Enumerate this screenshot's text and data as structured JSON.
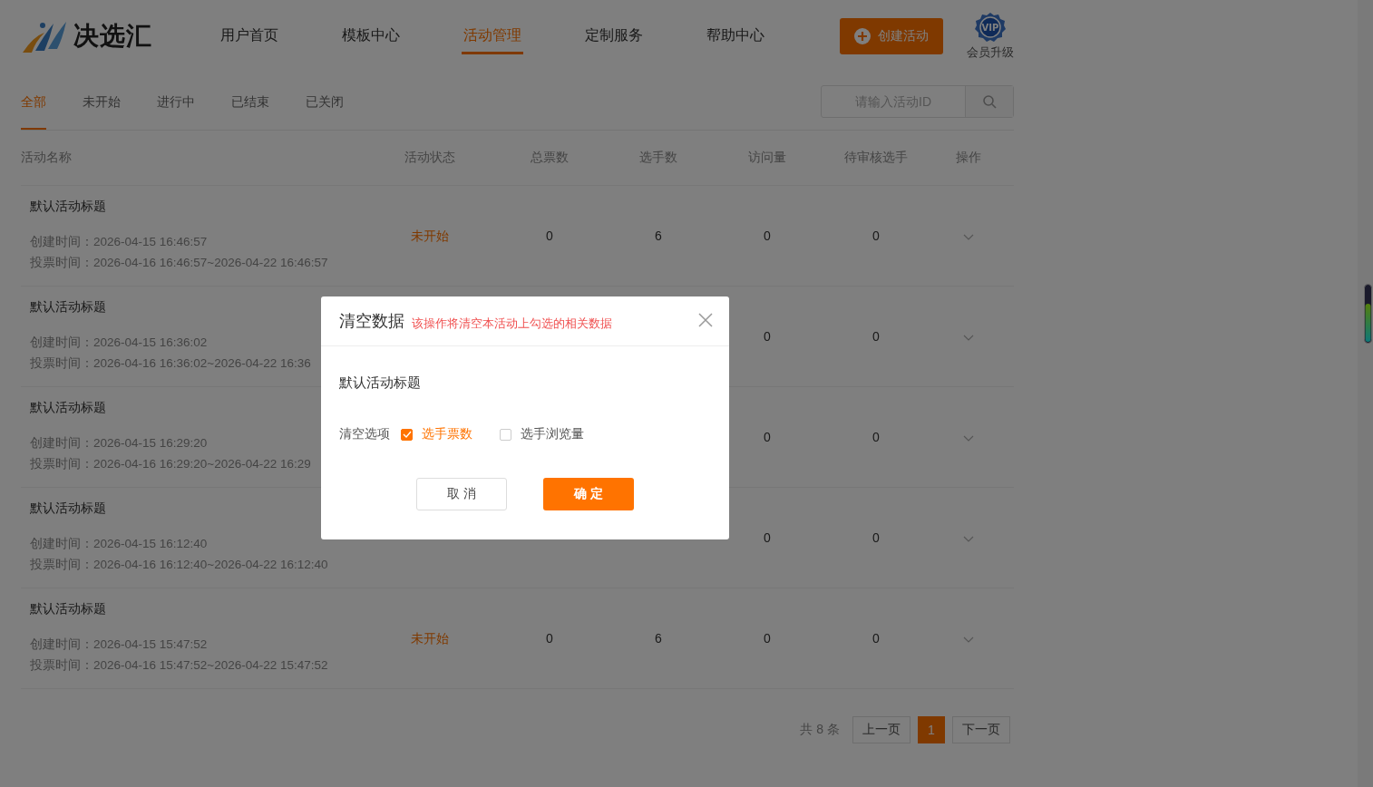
{
  "header": {
    "logo_text": "决选汇",
    "nav": [
      {
        "label": "用户首页",
        "selected": false
      },
      {
        "label": "模板中心",
        "selected": false
      },
      {
        "label": "活动管理",
        "selected": true
      },
      {
        "label": "定制服务",
        "selected": false
      },
      {
        "label": "帮助中心",
        "selected": false
      }
    ],
    "create_button": "创建活动",
    "vip_badge": "VIP",
    "vip_label": "会员升级"
  },
  "tabs": [
    {
      "label": "全部",
      "selected": true
    },
    {
      "label": "未开始",
      "selected": false
    },
    {
      "label": "进行中",
      "selected": false
    },
    {
      "label": "已结束",
      "selected": false
    },
    {
      "label": "已关闭",
      "selected": false
    }
  ],
  "search": {
    "placeholder": "请输入活动ID"
  },
  "table": {
    "columns": [
      "活动名称",
      "活动状态",
      "总票数",
      "选手数",
      "访问量",
      "待审核选手",
      "操作"
    ],
    "rows": [
      {
        "title": "默认活动标题",
        "created": "创建时间：2026-04-15 16:46:57",
        "voting": "投票时间：2026-04-16 16:46:57~2026-04-22 16:46:57",
        "status": "未开始",
        "total_votes": "0",
        "players": "6",
        "visits": "0",
        "pending": "0"
      },
      {
        "title": "默认活动标题",
        "created": "创建时间：2026-04-15 16:36:02",
        "voting": "投票时间：2026-04-16 16:36:02~2026-04-22 16:36",
        "visits": "0",
        "pending": "0"
      },
      {
        "title": "默认活动标题",
        "created": "创建时间：2026-04-15 16:29:20",
        "voting": "投票时间：2026-04-16 16:29:20~2026-04-22 16:29",
        "visits": "0",
        "pending": "0"
      },
      {
        "title": "默认活动标题",
        "created": "创建时间：2026-04-15 16:12:40",
        "voting": "投票时间：2026-04-16 16:12:40~2026-04-22 16:12:40",
        "visits": "0",
        "pending": "0"
      },
      {
        "title": "默认活动标题",
        "created": "创建时间：2026-04-15 15:47:52",
        "voting": "投票时间：2026-04-16 15:47:52~2026-04-22 15:47:52",
        "status": "未开始",
        "total_votes": "0",
        "players": "6",
        "visits": "0",
        "pending": "0"
      }
    ]
  },
  "pagination": {
    "total": "共 8 条",
    "prev": "上一页",
    "pages": [
      {
        "label": "1",
        "selected": true
      }
    ],
    "next": "下一页"
  },
  "dialog": {
    "title": "清空数据",
    "warning": "该操作将清空本活动上勾选的相关数据",
    "activity": "默认活动标题",
    "options_label": "清空选项",
    "options": [
      {
        "label": "选手票数",
        "checked": true
      },
      {
        "label": "选手浏览量",
        "checked": false
      }
    ],
    "cancel": "取 消",
    "confirm": "确 定"
  }
}
